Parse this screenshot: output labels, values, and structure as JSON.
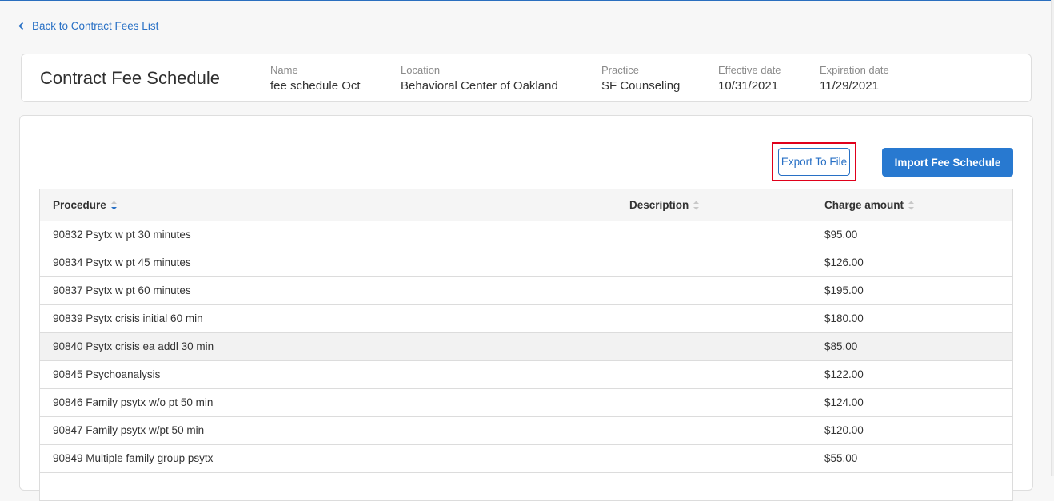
{
  "back_link": {
    "label": "Back to Contract Fees List"
  },
  "header": {
    "title": "Contract Fee Schedule",
    "fields": [
      {
        "label": "Name",
        "value": "fee schedule Oct"
      },
      {
        "label": "Location",
        "value": "Behavioral Center of Oakland"
      },
      {
        "label": "Practice",
        "value": "SF Counseling"
      },
      {
        "label": "Effective date",
        "value": "10/31/2021"
      },
      {
        "label": "Expiration date",
        "value": "11/29/2021"
      }
    ]
  },
  "toolbar": {
    "export_label": "Export To File",
    "import_label": "Import Fee Schedule"
  },
  "table": {
    "columns": [
      "Procedure",
      "Description",
      "Charge amount"
    ],
    "sorted_column": "Procedure",
    "rows": [
      {
        "procedure": "90832 Psytx w pt 30 minutes",
        "description": "",
        "amount": "$95.00"
      },
      {
        "procedure": "90834 Psytx w pt 45 minutes",
        "description": "",
        "amount": "$126.00"
      },
      {
        "procedure": "90837 Psytx w pt 60 minutes",
        "description": "",
        "amount": "$195.00"
      },
      {
        "procedure": "90839 Psytx crisis initial 60 min",
        "description": "",
        "amount": "$180.00"
      },
      {
        "procedure": "90840 Psytx crisis ea addl 30 min",
        "description": "",
        "amount": "$85.00"
      },
      {
        "procedure": "90845 Psychoanalysis",
        "description": "",
        "amount": "$122.00"
      },
      {
        "procedure": "90846 Family psytx w/o pt 50 min",
        "description": "",
        "amount": "$124.00"
      },
      {
        "procedure": "90847 Family psytx w/pt 50 min",
        "description": "",
        "amount": "$120.00"
      },
      {
        "procedure": "90849 Multiple family group psytx",
        "description": "",
        "amount": "$55.00"
      },
      {
        "procedure": "",
        "description": "",
        "amount": ""
      }
    ]
  },
  "colors": {
    "accent": "#2870c5",
    "primary_button": "#2879d0",
    "highlight": "#e0001b"
  }
}
